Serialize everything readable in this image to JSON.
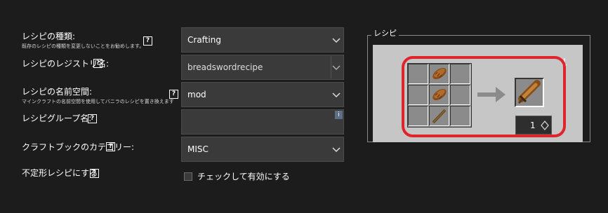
{
  "form": {
    "recipe_type": {
      "label": "レシピの種類:",
      "sublabel": "既存のレシピの種類を変更しないことをお勧めします。",
      "value": "Crafting"
    },
    "registry_name": {
      "label": "レシピのレジストリ名:",
      "value": "breadswordrecipe"
    },
    "namespace": {
      "label": "レシピの名前空間:",
      "sublabel": "マインクラフトの名前空間を使用してバニラのレシピを置き換えます",
      "value": "mod"
    },
    "group_name": {
      "label": "レシピグループ名:",
      "value": ""
    },
    "book_category": {
      "label": "クラフトブックのカテゴリー:",
      "value": "MISC"
    },
    "shapeless": {
      "label": "不定形レシピにする",
      "checkbox_label": "チェックして有効にする",
      "checked": false
    },
    "help_glyph": "?",
    "info_glyph": "i"
  },
  "recipe": {
    "legend": "レシピ",
    "grid": [
      [
        "",
        "bread",
        ""
      ],
      [
        "",
        "bread",
        ""
      ],
      [
        "",
        "stick",
        ""
      ]
    ],
    "result_item": "bread-sword",
    "result_count": "1",
    "accent_color": "#e0242c"
  }
}
